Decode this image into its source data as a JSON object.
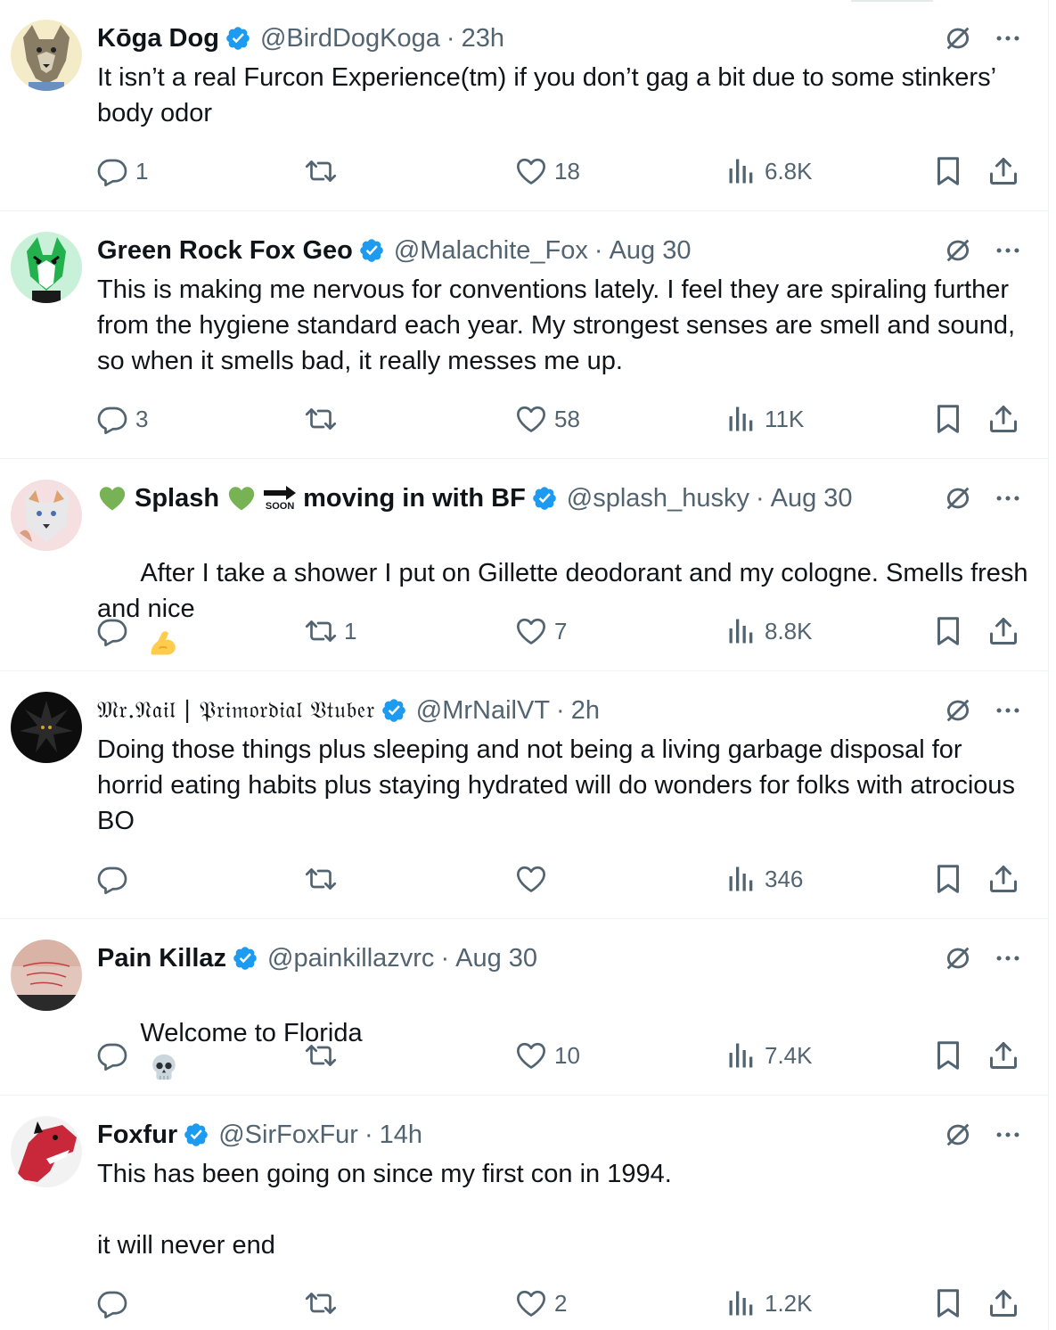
{
  "tweets": [
    {
      "name": "Kōga Dog",
      "handle": "@BirdDogKoga",
      "dot": "·",
      "time": "23h",
      "text": "It isn’t a real Furcon Experience(tm) if you don’t gag a bit due to some stinkers’ body odor",
      "replies": "1",
      "retweets": "",
      "likes": "18",
      "views": "6.8K"
    },
    {
      "name": "Green Rock Fox Geo",
      "handle": "@Malachite_Fox",
      "dot": "·",
      "time": "Aug 30",
      "text": "This is making me nervous for conventions lately. I feel they are spiraling further from the hygiene standard each year. My strongest senses are smell and sound, so when it smells bad, it really messes me up.",
      "replies": "3",
      "retweets": "",
      "likes": "58",
      "views": "11K"
    },
    {
      "name_prefix": "Splash",
      "name_suffix": "moving in with BF",
      "soon_label": "SOON",
      "handle": "@splash_husky",
      "dot": "·",
      "time": "Aug 30",
      "text": "After I take a shower I put on Gillette deodorant and my cologne. Smells fresh and nice",
      "replies": "",
      "retweets": "1",
      "likes": "7",
      "views": "8.8K"
    },
    {
      "name": "𝔐𝔯.𝔑𝔞𝔦𝔩 | 𝔓𝔯𝔦𝔪𝔬𝔯𝔡𝔦𝔞𝔩 𝔙𝔱𝔲𝔟𝔢𝔯",
      "handle": "@MrNailVT",
      "dot": "·",
      "time": "2h",
      "text": "Doing those things plus sleeping and not being a living garbage disposal for horrid eating habits plus staying hydrated will do wonders for folks with atrocious BO",
      "replies": "",
      "retweets": "",
      "likes": "",
      "views": "346"
    },
    {
      "name": "Pain Killaz",
      "handle": "@painkillazvrc",
      "dot": "·",
      "time": "Aug 30",
      "text": "Welcome to Florida",
      "replies": "",
      "retweets": "",
      "likes": "10",
      "views": "7.4K"
    },
    {
      "name": "Foxfur",
      "handle": "@SirFoxFur",
      "dot": "·",
      "time": "14h",
      "text": "This has been going on since my first con in 1994.\n\nit will never end",
      "replies": "",
      "retweets": "",
      "likes": "2",
      "views": "1.2K"
    }
  ],
  "colors": {
    "text": "#0f1419",
    "secondary": "#536471",
    "verified": "#1d9bf0",
    "divider": "#eff3f4"
  },
  "icons": [
    "verified-badge-icon",
    "grok-icon",
    "more-icon",
    "reply-icon",
    "retweet-icon",
    "like-icon",
    "views-icon",
    "bookmark-icon",
    "share-icon",
    "green-heart-emoji",
    "soon-arrow-emoji",
    "flexed-biceps-emoji",
    "skull-emoji"
  ]
}
